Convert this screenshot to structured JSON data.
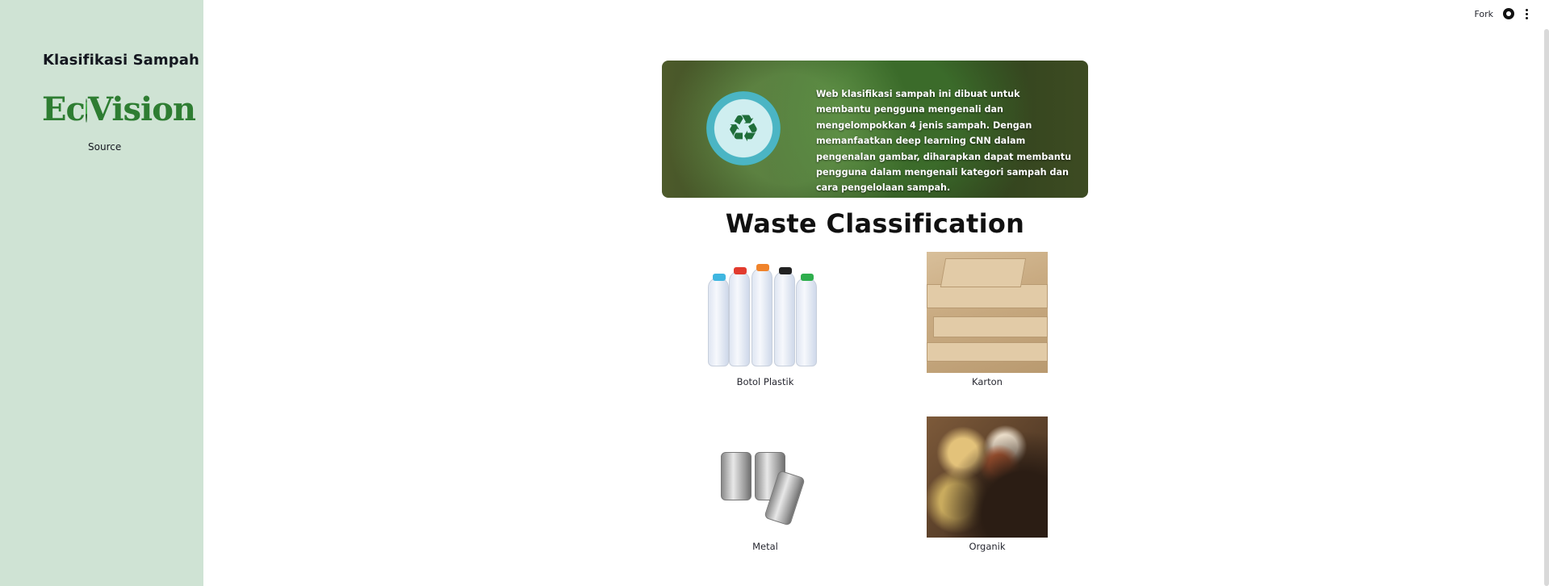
{
  "sidebar": {
    "title": "Klasifikasi Sampah",
    "logo_text_left": "Ec",
    "logo_text_right": "Vision",
    "source_link": "Source"
  },
  "topbar": {
    "fork_label": "Fork",
    "github_icon": "github-icon",
    "menu_icon": "kebab-menu-icon"
  },
  "banner": {
    "text": "Web klasifikasi sampah ini dibuat untuk membantu pengguna mengenali dan mengelompokkan 4 jenis sampah. Dengan memanfaatkan deep learning CNN dalam pengenalan gambar, diharapkan dapat membantu pengguna dalam mengenali kategori sampah dan cara pengelolaan sampah."
  },
  "main": {
    "title": "Waste Classification",
    "categories": [
      {
        "label": "Botol Plastik"
      },
      {
        "label": "Karton"
      },
      {
        "label": "Metal"
      },
      {
        "label": "Organik"
      }
    ]
  },
  "colors": {
    "sidebar_bg": "#cfe3d4",
    "logo_green": "#2e7d32"
  }
}
